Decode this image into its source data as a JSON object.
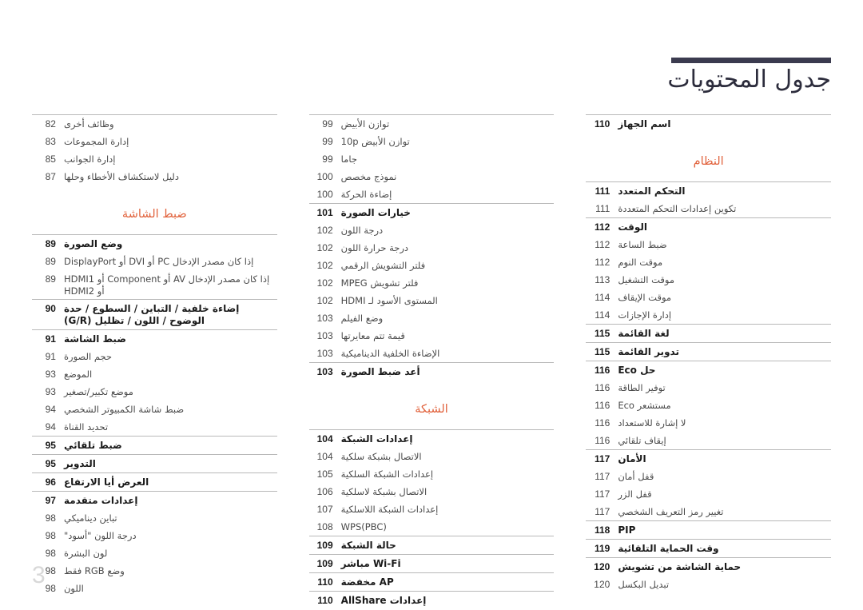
{
  "header": {
    "title": "جدول المحتويات",
    "rule_color": "#3b3b4f"
  },
  "folio": "3",
  "colors": {
    "section_header": "#e1623c",
    "rule": "#b9b9b9",
    "title": "#2c2c3c",
    "folio": "#d8d8d8"
  },
  "columns": [
    {
      "groups": [
        {
          "section": null,
          "entries": [
            {
              "label": "اسم الجهاز",
              "page": "110",
              "level": 1
            }
          ]
        },
        {
          "section": "النظام",
          "entries": [
            {
              "label": "التحكم المتعدد",
              "page": "111",
              "level": 1
            },
            {
              "label": "تكوين إعدادات التحكم المتعددة",
              "page": "111",
              "level": 2
            }
          ]
        },
        {
          "section": null,
          "entries": [
            {
              "label": "الوقت",
              "page": "112",
              "level": 1
            },
            {
              "label": "ضبط الساعة",
              "page": "112",
              "level": 2
            },
            {
              "label": "موقت النوم",
              "page": "112",
              "level": 2
            },
            {
              "label": "موقت التشغيل",
              "page": "113",
              "level": 2
            },
            {
              "label": "موقت الإيقاف",
              "page": "114",
              "level": 2
            },
            {
              "label": "إدارة الإجازات",
              "page": "114",
              "level": 2
            }
          ]
        },
        {
          "section": null,
          "entries": [
            {
              "label": "لغة القائمة",
              "page": "115",
              "level": 1
            }
          ]
        },
        {
          "section": null,
          "entries": [
            {
              "label": "تدوير القائمة",
              "page": "115",
              "level": 1
            }
          ]
        },
        {
          "section": null,
          "entries": [
            {
              "label": "حل Eco",
              "page": "116",
              "level": 1
            },
            {
              "label": "توفير الطاقة",
              "page": "116",
              "level": 2
            },
            {
              "label": "مستشعر Eco",
              "page": "116",
              "level": 2
            },
            {
              "label": "لا إشارة للاستعداد",
              "page": "116",
              "level": 2
            },
            {
              "label": "إيقاف تلقائي",
              "page": "116",
              "level": 2
            }
          ]
        },
        {
          "section": null,
          "entries": [
            {
              "label": "الأمان",
              "page": "117",
              "level": 1
            },
            {
              "label": "قفل أمان",
              "page": "117",
              "level": 2
            },
            {
              "label": "قفل الزر",
              "page": "117",
              "level": 2
            },
            {
              "label": "تغيير رمز التعريف الشخصي",
              "page": "117",
              "level": 2
            }
          ]
        },
        {
          "section": null,
          "entries": [
            {
              "label": "PIP",
              "page": "118",
              "level": 1
            }
          ]
        },
        {
          "section": null,
          "entries": [
            {
              "label": "وقت الحماية التلقائية",
              "page": "119",
              "level": 1
            }
          ]
        },
        {
          "section": null,
          "entries": [
            {
              "label": "حماية الشاشة من تشويش",
              "page": "120",
              "level": 1
            },
            {
              "label": "تبديل البكسل",
              "page": "120",
              "level": 2
            }
          ]
        }
      ]
    },
    {
      "groups": [
        {
          "section": null,
          "entries": [
            {
              "label": "توازن الأبيض",
              "page": "99",
              "level": 2
            },
            {
              "label": "توازن الأبيض 10p",
              "page": "99",
              "level": 2
            },
            {
              "label": "جاما",
              "page": "99",
              "level": 2
            },
            {
              "label": "نموذج مخصص",
              "page": "100",
              "level": 2
            },
            {
              "label": "إضاءة الحركة",
              "page": "100",
              "level": 2
            }
          ]
        },
        {
          "section": null,
          "entries": [
            {
              "label": "خيارات الصورة",
              "page": "101",
              "level": 1
            },
            {
              "label": "درجة اللون",
              "page": "102",
              "level": 2
            },
            {
              "label": "درجة حرارة اللون",
              "page": "102",
              "level": 2
            },
            {
              "label": "فلتر التشويش الرقمي",
              "page": "102",
              "level": 2
            },
            {
              "label": "فلتر تشويش MPEG",
              "page": "102",
              "level": 2
            },
            {
              "label": "المستوى الأسود لـ HDMI",
              "page": "102",
              "level": 2
            },
            {
              "label": "وضع الفيلم",
              "page": "103",
              "level": 2
            },
            {
              "label": "قيمة تتم معايرتها",
              "page": "103",
              "level": 2
            },
            {
              "label": "الإضاءة الخلفية الديناميكية",
              "page": "103",
              "level": 2
            }
          ]
        },
        {
          "section": null,
          "entries": [
            {
              "label": "أعد ضبط الصورة",
              "page": "103",
              "level": 1
            }
          ]
        },
        {
          "section": "الشبكة",
          "entries": [
            {
              "label": "إعدادات الشبكة",
              "page": "104",
              "level": 1
            },
            {
              "label": "الاتصال بشبكة سلكية",
              "page": "104",
              "level": 2
            },
            {
              "label": "إعدادات الشبكة السلكية",
              "page": "105",
              "level": 2
            },
            {
              "label": "الاتصال بشبكة لاسلكية",
              "page": "106",
              "level": 2
            },
            {
              "label": "إعدادات الشبكة اللاسلكية",
              "page": "107",
              "level": 2
            },
            {
              "label": "WPS(PBC)",
              "page": "108",
              "level": 2
            }
          ]
        },
        {
          "section": null,
          "entries": [
            {
              "label": "حالة الشبكة",
              "page": "109",
              "level": 1
            }
          ]
        },
        {
          "section": null,
          "entries": [
            {
              "label": "Wi-Fi مباشر",
              "page": "109",
              "level": 1
            }
          ]
        },
        {
          "section": null,
          "entries": [
            {
              "label": "AP مخفضة",
              "page": "110",
              "level": 1
            }
          ]
        },
        {
          "section": null,
          "entries": [
            {
              "label": "إعدادات AllShare",
              "page": "110",
              "level": 1
            }
          ]
        }
      ]
    },
    {
      "groups": [
        {
          "section": null,
          "entries": [
            {
              "label": "وظائف أخرى",
              "page": "82",
              "level": 2
            },
            {
              "label": "إدارة المجموعات",
              "page": "83",
              "level": 2
            },
            {
              "label": "إدارة الجوانب",
              "page": "85",
              "level": 2
            },
            {
              "label": "دليل لاستكشاف الأخطاء وحلها",
              "page": "87",
              "level": 2
            }
          ]
        },
        {
          "section": "ضبط الشاشة",
          "entries": [
            {
              "label": "وضع الصورة",
              "page": "89",
              "level": 1
            },
            {
              "label": "إذا كان مصدر الإدخال PC أو DVI أو DisplayPort",
              "page": "89",
              "level": 2
            },
            {
              "label": "إذا كان مصدر الإدخال AV أو Component أو HDMI1 أو HDMI2",
              "page": "89",
              "level": 2
            }
          ]
        },
        {
          "section": null,
          "entries": [
            {
              "label": "إضاءة خلفية / التباين / السطوع / حدة الوضوح / اللون / تظليل (G/R)",
              "page": "90",
              "level": 1
            }
          ]
        },
        {
          "section": null,
          "entries": [
            {
              "label": "ضبط الشاشة",
              "page": "91",
              "level": 1
            },
            {
              "label": "حجم الصورة",
              "page": "91",
              "level": 2
            },
            {
              "label": "الموضع",
              "page": "93",
              "level": 2
            },
            {
              "label": "موضع تكبير/تصغير",
              "page": "93",
              "level": 2
            },
            {
              "label": "ضبط شاشة الكمبيوتر الشخصي",
              "page": "94",
              "level": 2
            },
            {
              "label": "تحديد القناة",
              "page": "94",
              "level": 2
            }
          ]
        },
        {
          "section": null,
          "entries": [
            {
              "label": "ضبط تلقائي",
              "page": "95",
              "level": 1
            }
          ]
        },
        {
          "section": null,
          "entries": [
            {
              "label": "التدوير",
              "page": "95",
              "level": 1
            }
          ]
        },
        {
          "section": null,
          "entries": [
            {
              "label": "العرض أيا الارتفاع",
              "page": "96",
              "level": 1
            }
          ]
        },
        {
          "section": null,
          "entries": [
            {
              "label": "إعدادات متقدمة",
              "page": "97",
              "level": 1
            },
            {
              "label": "تباين ديناميكي",
              "page": "98",
              "level": 2
            },
            {
              "label": "درجة اللون \"أسود\"",
              "page": "98",
              "level": 2
            },
            {
              "label": "لون البشرة",
              "page": "98",
              "level": 2
            },
            {
              "label": "وضع RGB فقط",
              "page": "98",
              "level": 2
            },
            {
              "label": "اللون",
              "page": "98",
              "level": 2
            }
          ]
        }
      ]
    }
  ]
}
